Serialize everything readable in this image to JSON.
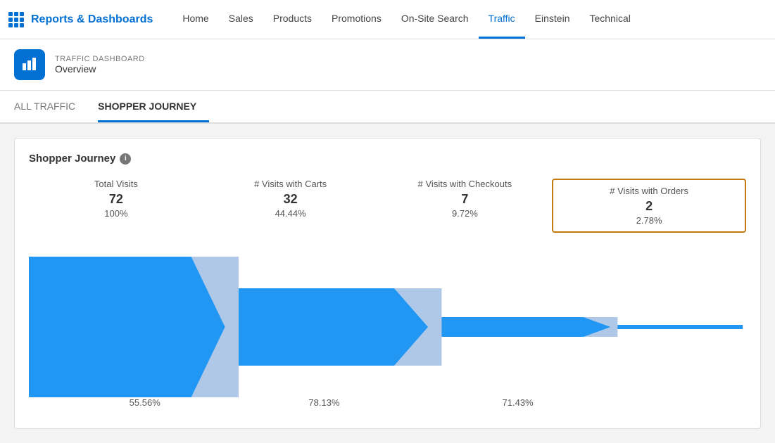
{
  "app": {
    "title": "Reports & Dashboards"
  },
  "nav": {
    "items": [
      {
        "label": "Home",
        "active": false
      },
      {
        "label": "Sales",
        "active": false
      },
      {
        "label": "Products",
        "active": false
      },
      {
        "label": "Promotions",
        "active": false
      },
      {
        "label": "On-Site Search",
        "active": false
      },
      {
        "label": "Traffic",
        "active": true
      },
      {
        "label": "Einstein",
        "active": false
      },
      {
        "label": "Technical",
        "active": false
      }
    ]
  },
  "dashboard": {
    "label": "TRAFFIC DASHBOARD",
    "subtitle": "Overview"
  },
  "subtabs": [
    {
      "label": "ALL TRAFFIC",
      "active": false
    },
    {
      "label": "SHOPPER JOURNEY",
      "active": true
    }
  ],
  "section": {
    "title": "Shopper Journey",
    "info_icon": "i"
  },
  "metrics": [
    {
      "label": "Total Visits",
      "value": "72",
      "pct": "100%",
      "highlighted": false
    },
    {
      "label": "# Visits with Carts",
      "value": "32",
      "pct": "44.44%",
      "highlighted": false
    },
    {
      "label": "# Visits with Checkouts",
      "value": "7",
      "pct": "9.72%",
      "highlighted": false
    },
    {
      "label": "# Visits with Orders",
      "value": "2",
      "pct": "2.78%",
      "highlighted": true
    }
  ],
  "funnel": {
    "bottom_pcts": [
      {
        "value": "55.56%",
        "left_pct": "14"
      },
      {
        "value": "78.13%",
        "left_pct": "39"
      },
      {
        "value": "71.43%",
        "left_pct": "66"
      }
    ]
  }
}
